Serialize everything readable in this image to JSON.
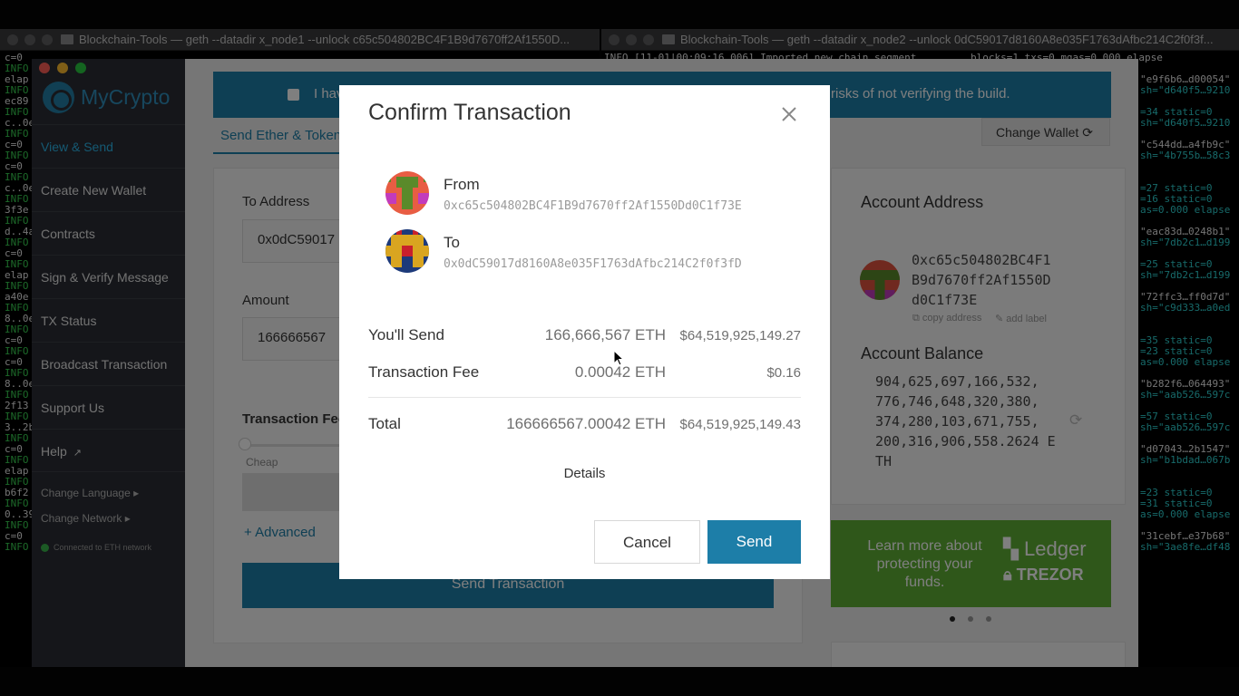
{
  "terminal1": {
    "title": "Blockchain-Tools — geth --datadir x_node1 --unlock c65c504802BC4F1B9d7670ff2Af1550D...",
    "lines": [
      "c=0",
      "INFO",
      "elap",
      "INFO",
      "ec89",
      "INFO",
      "c..0e",
      "INFO",
      "c=0",
      "INFO",
      "c=0",
      "INFO",
      "c..0e",
      "INFO",
      "3f3e",
      "INFO",
      "d..4a",
      "INFO",
      "c=0",
      "INFO",
      "elap",
      "INFO",
      "a40e",
      "INFO",
      "8..0e",
      "INFO",
      "c=0",
      "INFO",
      "c=0",
      "INFO",
      "8..0e",
      "INFO",
      "2f13",
      "INFO",
      "3..2b",
      "INFO",
      "c=0",
      "INFO",
      "elap",
      "INFO",
      "b6f2",
      "INFO",
      "0..39",
      "INFO",
      "c=0",
      "INFO"
    ]
  },
  "terminal2": {
    "title": "Blockchain-Tools — geth --datadir x_node2 --unlock 0dC59017d8160A8e035F1763dAfbc214C2f0f3f...",
    "first_line": "INFO [11-01|00:09:16.006] Imported new chain segment         blocks=1 txs=0 mgas=0.000 elapse",
    "lines": [
      "\"e9f6b6…d00054\"",
      "sh=\"d640f5…9210",
      "",
      "=34 static=0",
      "sh=\"d640f5…9210",
      "",
      "\"c544dd…a4fb9c\"",
      "sh=\"4b755b…58c3",
      "",
      "",
      "=27 static=0",
      "=16 static=0",
      "as=0.000 elapse",
      "",
      "\"eac83d…0248b1\"",
      "sh=\"7db2c1…d199",
      "",
      "=25 static=0",
      "sh=\"7db2c1…d199",
      "",
      "\"72ffc3…ff0d7d\"",
      "sh=\"c9d333…a0ed",
      "",
      "",
      "=35 static=0",
      "=23 static=0",
      "as=0.000 elapse",
      "",
      "\"b282f6…064493\"",
      "sh=\"aab526…597c",
      "",
      "=57 static=0",
      "sh=\"aab526…597c",
      "",
      "\"d07043…2b1547\"",
      "sh=\"b1bdad…067b",
      "",
      "",
      "=23 static=0",
      "=31 static=0",
      "as=0.000 elapse",
      "",
      "\"31cebf…e37b68\"",
      "sh=\"3ae8fe…df48"
    ]
  },
  "app": {
    "logo_text": "MyCrypto",
    "nav": [
      {
        "label": "View & Send"
      },
      {
        "label": "Create New Wallet"
      },
      {
        "label": "Contracts"
      },
      {
        "label": "Sign & Verify Message"
      },
      {
        "label": "TX Status"
      },
      {
        "label": "Broadcast Transaction"
      },
      {
        "label": "Support Us"
      },
      {
        "label": "Help"
      }
    ],
    "change_language": "Change Language",
    "change_network": "Change Network",
    "connected": "Connected to ETH network",
    "banner_left": "I hav",
    "banner_right": "risks of not verifying the build.",
    "tab_label": "Send Ether & Token",
    "change_wallet": "Change Wallet",
    "to_address_label": "To Address",
    "to_address_value": "0x0dC59017",
    "amount_label": "Amount",
    "amount_value": "166666567",
    "tx_fee_label": "Transaction Fee",
    "cheap_label": "Cheap",
    "advanced_label": "+ Advanced",
    "send_tx_button": "Send Transaction",
    "account_address_title": "Account Address",
    "account_address_lines": [
      "0xc65c504802BC4F1",
      "B9d7670ff2Af1550D",
      "d0C1f73E"
    ],
    "copy_address": "copy address",
    "add_label": "add label",
    "account_balance_title": "Account Balance",
    "balance_lines": [
      "904,625,697,166,532,",
      "776,746,648,320,380,",
      "374,280,103,671,755,",
      "200,316,906,558.2624 E",
      "TH"
    ],
    "ledger_text": [
      "Learn more about",
      "protecting your",
      "funds."
    ],
    "ledger_brand": "Ledger",
    "trezor_brand": "TREZOR"
  },
  "modal": {
    "title": "Confirm Transaction",
    "from_label": "From",
    "from_address": "0xc65c504802BC4F1B9d7670ff2Af1550Dd0C1f73E",
    "to_label": "To",
    "to_address": "0x0dC59017d8160A8e035F1763dAfbc214C2f0f3fD",
    "send_label": "You'll Send",
    "send_eth": "166,666,567 ETH",
    "send_usd": "$64,519,925,149.27",
    "fee_label": "Transaction Fee",
    "fee_eth": "0.00042 ETH",
    "fee_usd": "$0.16",
    "total_label": "Total",
    "total_eth": "166666567.00042 ETH",
    "total_usd": "$64,519,925,149.43",
    "details": "Details",
    "cancel": "Cancel",
    "send": "Send"
  },
  "colors": {
    "accent": "#1d7ea8",
    "sidebar": "#2a2d34",
    "ledger_green": "#5eae35"
  }
}
